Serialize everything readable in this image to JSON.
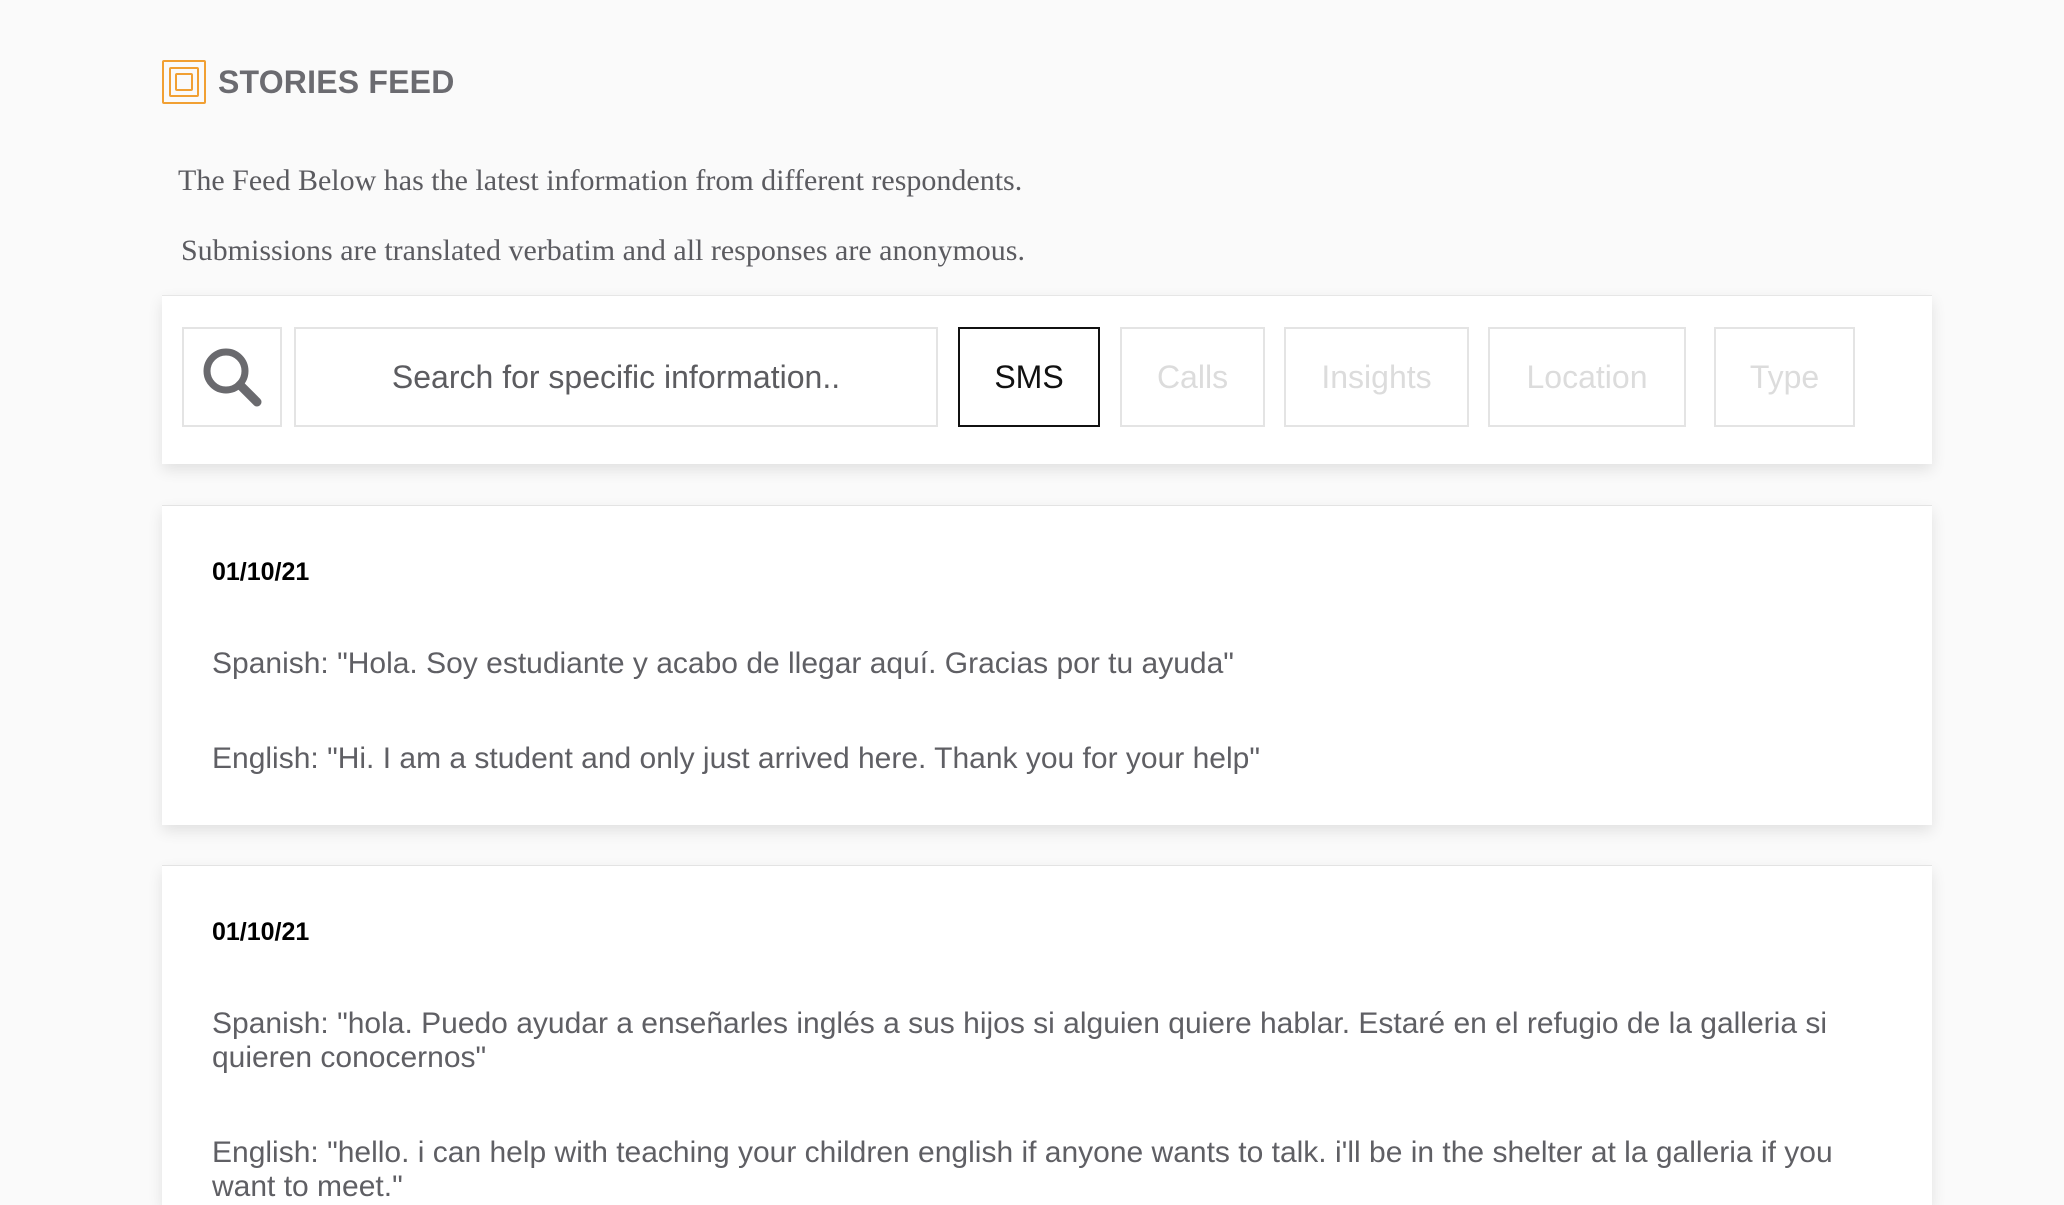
{
  "header": {
    "title": "STORIES FEED",
    "logo_icon": "nested-squares-logo"
  },
  "intro": {
    "line1": "The Feed Below has the latest information from different respondents.",
    "line2": "Submissions are translated verbatim and all responses are anonymous."
  },
  "toolbar": {
    "search_icon": "search-icon",
    "search_placeholder": "Search for specific information..",
    "filters": [
      {
        "label": "SMS",
        "active": true
      },
      {
        "label": "Calls",
        "active": false
      },
      {
        "label": "Insights",
        "active": false
      },
      {
        "label": "Location",
        "active": false
      },
      {
        "label": "Type",
        "active": false
      }
    ]
  },
  "colors": {
    "accent": "#f1a033",
    "text": "#5f5f64",
    "active_border": "#111111",
    "inactive_text": "#dcdcdc"
  },
  "feed": [
    {
      "date": "01/10/21",
      "spanish": "Spanish: \"Hola. Soy estudiante y acabo de llegar aquí. Gracias por tu ayuda\"",
      "english": "English: \"Hi. I am a student and only just arrived here. Thank you for your help\""
    },
    {
      "date": "01/10/21",
      "spanish": "Spanish: \"hola. Puedo ayudar a enseñarles inglés a sus hijos si alguien quiere hablar. Estaré en el refugio de la galleria si quieren conocernos\"",
      "english": "English: \"hello. i can help with teaching your children english if anyone wants to talk. i'll be in the shelter at la galleria if you want to meet.\""
    }
  ]
}
